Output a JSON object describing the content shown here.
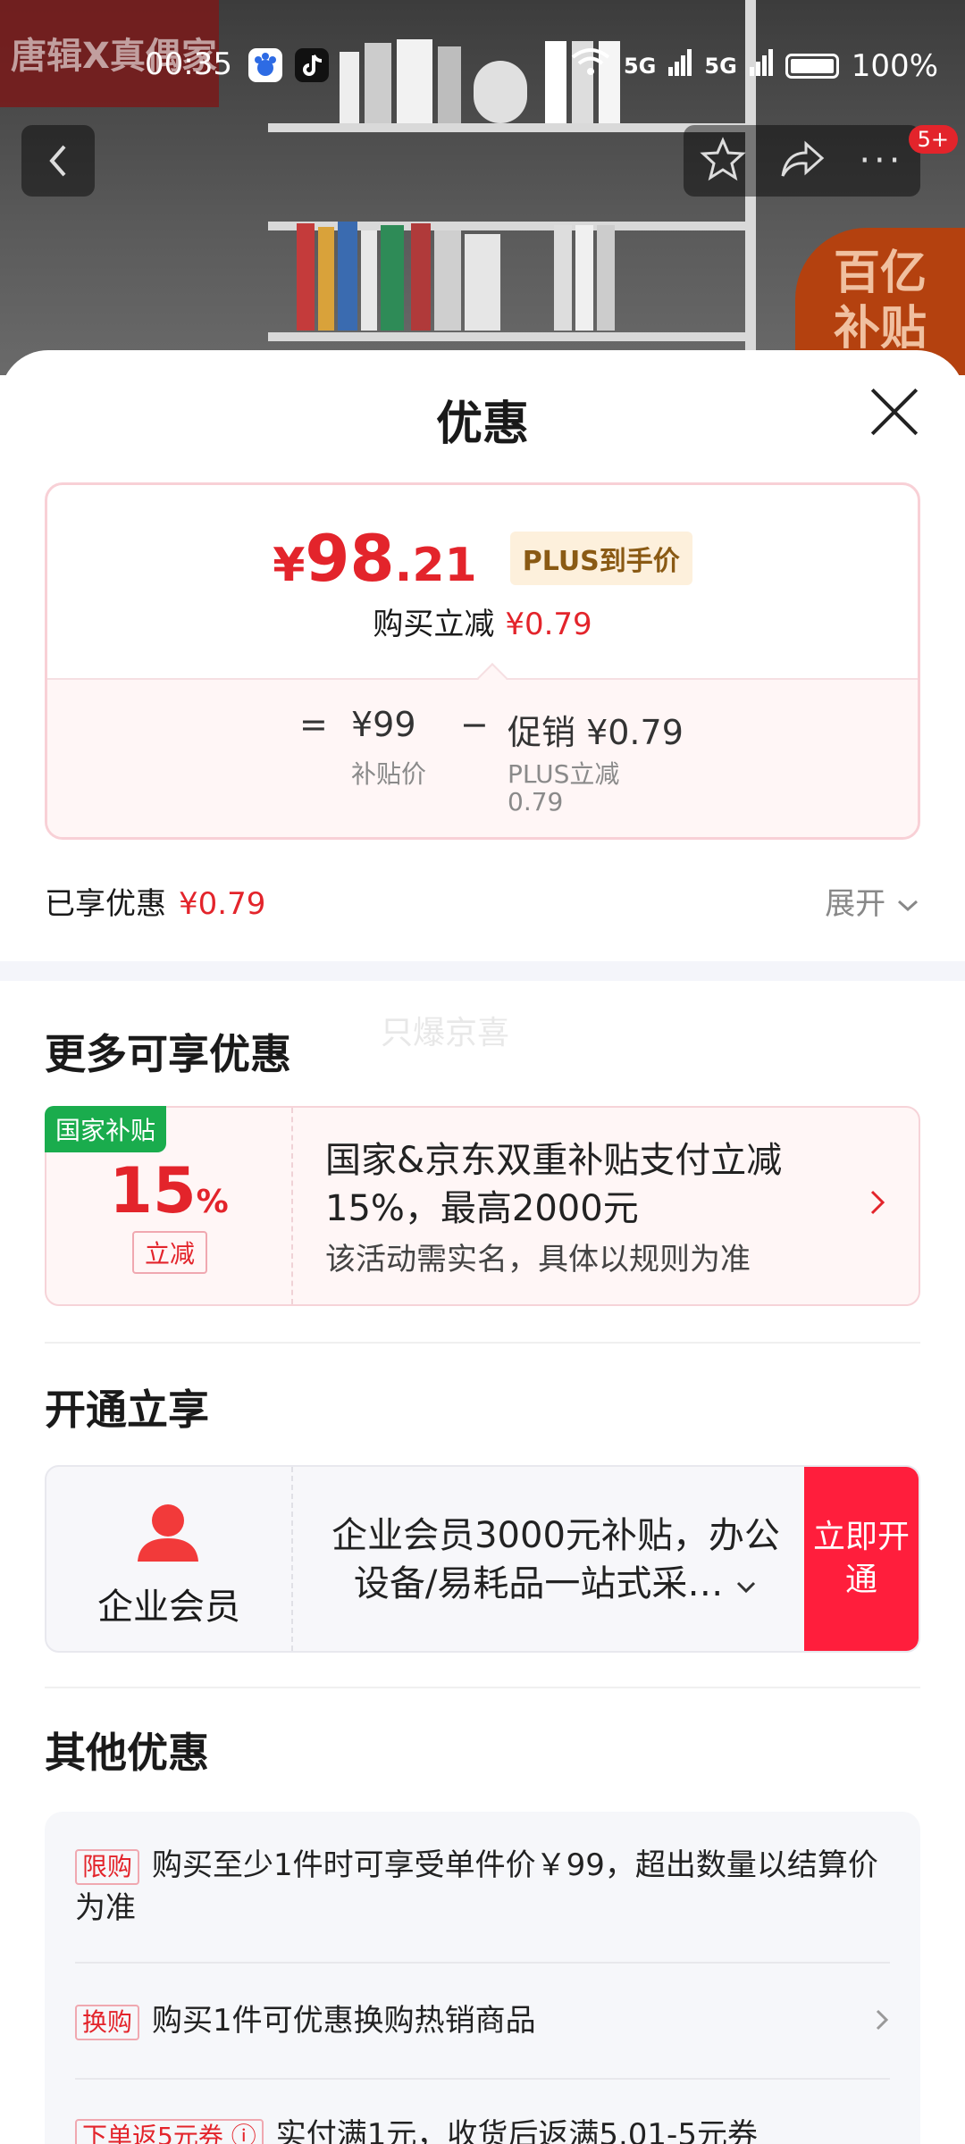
{
  "status": {
    "time": "00:35",
    "signal1": "5G",
    "signal2": "5G",
    "battery": "100%"
  },
  "background": {
    "brand_tag": "唐辑X真偶家",
    "subsidy_badge_line1": "百亿",
    "subsidy_badge_line2": "补贴",
    "notification_count": "5+"
  },
  "sheet": {
    "title": "优惠",
    "price_card": {
      "currency": "¥",
      "price_int": "98",
      "price_dec": ".21",
      "plus_tag": "PLUS到手价",
      "reduce_label": "购买立减",
      "reduce_amount": "¥0.79",
      "formula_eq": "=",
      "base_price": "¥99",
      "base_label": "补贴价",
      "formula_minus": "−",
      "promo_label": "促销 ¥0.79",
      "promo_detail": "PLUS立减",
      "promo_detail_amount": "0.79"
    },
    "enjoyed_label": "已享优惠",
    "enjoyed_amount": "¥0.79",
    "expand_label": "展开",
    "more_title": "更多可享优惠",
    "watermark": "只爆京喜",
    "coupon": {
      "flag": "国家补贴",
      "percent": "15",
      "percent_sign": "%",
      "sub_label": "立减",
      "text": "国家&京东双重补贴支付立减15%，最高2000元",
      "note": "该活动需实名，具体以规则为准"
    },
    "open_title": "开通立享",
    "member": {
      "label": "企业会员",
      "text": "企业会员3000元补贴，办公设备/易耗品一站式采…",
      "button": "立即开通"
    },
    "other_title": "其他优惠",
    "other_items": [
      {
        "tag": "限购",
        "text": "购买至少1件时可享受单件价￥99，超出数量以结算价为准"
      },
      {
        "tag": "换购",
        "text": "购买1件可优惠换购热销商品"
      },
      {
        "tag": "下单返5元券 ⓘ",
        "text": "实付满1元，收货后返满5.01-5元券"
      }
    ]
  }
}
